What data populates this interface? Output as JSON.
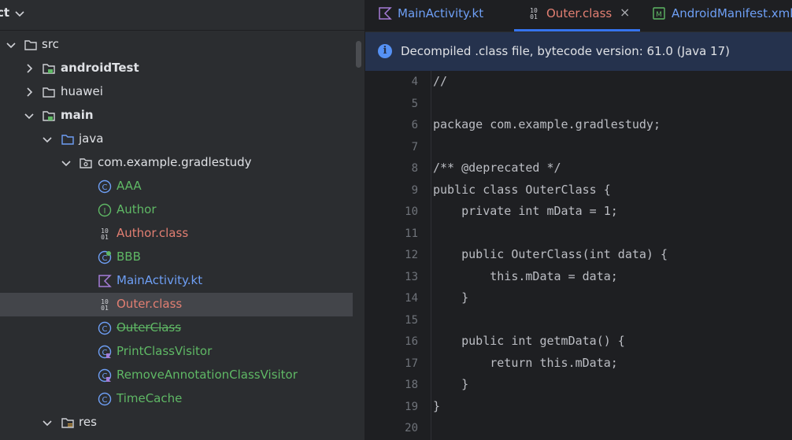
{
  "project_panel": {
    "title": "ct",
    "tree": [
      {
        "label": "src",
        "expanded": true,
        "icon": "folder-icon"
      },
      {
        "label": "androidTest",
        "expanded": false,
        "icon": "module-folder-icon"
      },
      {
        "label": "huawei",
        "expanded": false,
        "icon": "folder-icon"
      },
      {
        "label": "main",
        "expanded": true,
        "icon": "module-folder-icon"
      },
      {
        "label": "java",
        "expanded": true,
        "icon": "source-folder-icon"
      },
      {
        "label": "com.example.gradlestudy",
        "expanded": true,
        "icon": "package-icon"
      },
      {
        "label": "AAA",
        "icon": "class-icon"
      },
      {
        "label": "Author",
        "icon": "interface-icon"
      },
      {
        "label": "Author.class",
        "icon": "binary-class-icon"
      },
      {
        "label": "BBB",
        "icon": "class-icon"
      },
      {
        "label": "MainActivity.kt",
        "icon": "kotlin-file-icon"
      },
      {
        "label": "Outer.class",
        "icon": "binary-class-icon",
        "selected": true
      },
      {
        "label": "OuterClass",
        "icon": "class-icon",
        "deprecated": true
      },
      {
        "label": "PrintClassVisitor",
        "icon": "class-icon"
      },
      {
        "label": "RemoveAnnotationClassVisitor",
        "icon": "class-icon"
      },
      {
        "label": "TimeCache",
        "icon": "class-icon"
      },
      {
        "label": "res",
        "expanded": true,
        "icon": "resource-folder-icon"
      }
    ]
  },
  "editor": {
    "tabs": [
      {
        "label": "MainActivity.kt",
        "icon": "kotlin-file-icon",
        "active": false
      },
      {
        "label": "Outer.class",
        "icon": "binary-class-icon",
        "active": true,
        "close": "×"
      },
      {
        "label": "AndroidManifest.xml",
        "icon": "manifest-icon",
        "active": false
      }
    ],
    "banner": {
      "icon": "i",
      "text": "Decompiled .class file, bytecode version: 61.0 (Java 17)"
    },
    "lines": [
      {
        "n": "4",
        "code": "//"
      },
      {
        "n": "5",
        "code": ""
      },
      {
        "n": "6",
        "code": "package com.example.gradlestudy;"
      },
      {
        "n": "7",
        "code": ""
      },
      {
        "n": "8",
        "code": "/** @deprecated */"
      },
      {
        "n": "9",
        "code": "public class OuterClass {"
      },
      {
        "n": "10",
        "code": "    private int mData = 1;"
      },
      {
        "n": "11",
        "code": ""
      },
      {
        "n": "12",
        "code": "    public OuterClass(int data) {"
      },
      {
        "n": "13",
        "code": "        this.mData = data;"
      },
      {
        "n": "14",
        "code": "    }"
      },
      {
        "n": "15",
        "code": ""
      },
      {
        "n": "16",
        "code": "    public int getmData() {"
      },
      {
        "n": "17",
        "code": "        return this.mData;"
      },
      {
        "n": "18",
        "code": "    }"
      },
      {
        "n": "19",
        "code": "}"
      },
      {
        "n": "20",
        "code": ""
      }
    ]
  },
  "colors": {
    "accent": "#3574f0",
    "class_green": "#5fb865",
    "binary_salmon": "#e27f72",
    "kotlin_blue": "#6e9ff5"
  }
}
